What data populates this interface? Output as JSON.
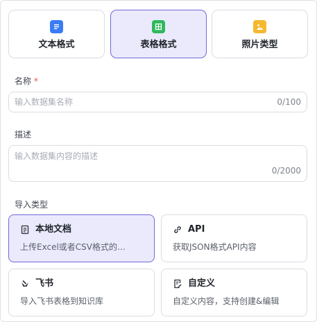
{
  "formats": [
    {
      "label": "文本格式",
      "icon": "document-icon",
      "color": "#3b7cf5",
      "selected": false
    },
    {
      "label": "表格格式",
      "icon": "table-icon",
      "color": "#2fb85c",
      "selected": true
    },
    {
      "label": "照片类型",
      "icon": "image-icon",
      "color": "#f5b82e",
      "selected": false
    }
  ],
  "name_field": {
    "label": "名称",
    "required_mark": "*",
    "placeholder": "输入数据集名称",
    "counter": "0/100"
  },
  "description_field": {
    "label": "描述",
    "placeholder": "输入数据集内容的描述",
    "counter": "0/2000"
  },
  "import_type": {
    "label": "导入类型",
    "options": [
      {
        "title": "本地文档",
        "desc": "上传Excel或者CSV格式的…",
        "icon": "file-icon",
        "selected": true
      },
      {
        "title": "API",
        "desc": "获取JSON格式API内容",
        "icon": "link-icon",
        "selected": false
      },
      {
        "title": "飞书",
        "desc": "导入飞书表格到知识库",
        "icon": "feishu-icon",
        "selected": false
      },
      {
        "title": "自定义",
        "desc": "自定义内容，支持创建&编辑",
        "icon": "edit-doc-icon",
        "selected": false
      }
    ]
  },
  "colors": {
    "accent_border": "#6e68d8",
    "accent_bg": "#eaeafc",
    "required": "#f54a45"
  }
}
